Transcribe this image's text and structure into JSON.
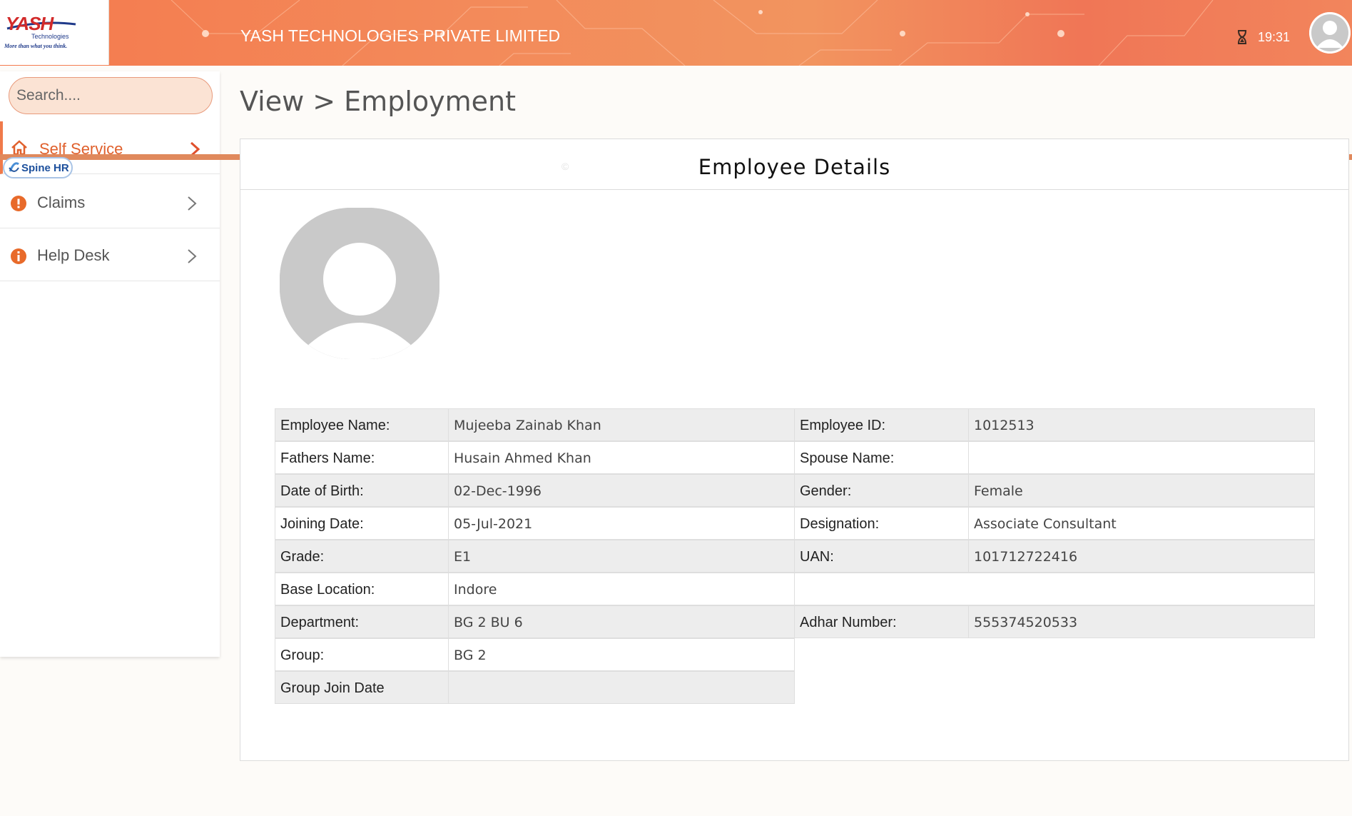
{
  "header": {
    "company_name": "YASH TECHNOLOGIES PRIVATE LIMITED",
    "time": "19:31",
    "logo_word": "YASH",
    "logo_sub": "Technologies",
    "logo_tagline": "More than what you think."
  },
  "sidebar": {
    "search_placeholder": "Search....",
    "items": [
      {
        "label": "Self Service",
        "icon": "home-icon",
        "active": true
      },
      {
        "label": "Claims",
        "icon": "exclamation-circle-icon",
        "active": false
      },
      {
        "label": "Help Desk",
        "icon": "info-circle-icon",
        "active": false
      }
    ],
    "badge": "Spine HR"
  },
  "page": {
    "breadcrumb": "View > Employment",
    "panel_title": "Employee Details",
    "copyright": "©"
  },
  "details": {
    "left": [
      {
        "label": "Employee Name:",
        "value": "Mujeeba Zainab Khan"
      },
      {
        "label": "Fathers Name:",
        "value": "Husain Ahmed Khan"
      },
      {
        "label": "Date of Birth:",
        "value": "02-Dec-1996"
      },
      {
        "label": "Joining Date:",
        "value": "05-Jul-2021"
      },
      {
        "label": "Grade:",
        "value": "E1"
      },
      {
        "label": "Base Location:",
        "value": "Indore"
      },
      {
        "label": "Department:",
        "value": "BG 2 BU 6"
      },
      {
        "label": "Group:",
        "value": "BG 2"
      },
      {
        "label": "Group Join Date",
        "value": ""
      }
    ],
    "right": [
      {
        "label": "Employee ID:",
        "value": "1012513"
      },
      {
        "label": "Spouse Name:",
        "value": ""
      },
      {
        "label": "Gender:",
        "value": "Female"
      },
      {
        "label": "Designation:",
        "value": "Associate Consultant"
      },
      {
        "label": "UAN:",
        "value": "101712722416"
      },
      {
        "label": "",
        "value": ""
      },
      {
        "label": "Adhar Number:",
        "value": "555374520533"
      }
    ]
  },
  "colors": {
    "accent": "#f07a4a",
    "header_gradient_start": "#f47a4e",
    "row_shade": "#ededed"
  }
}
